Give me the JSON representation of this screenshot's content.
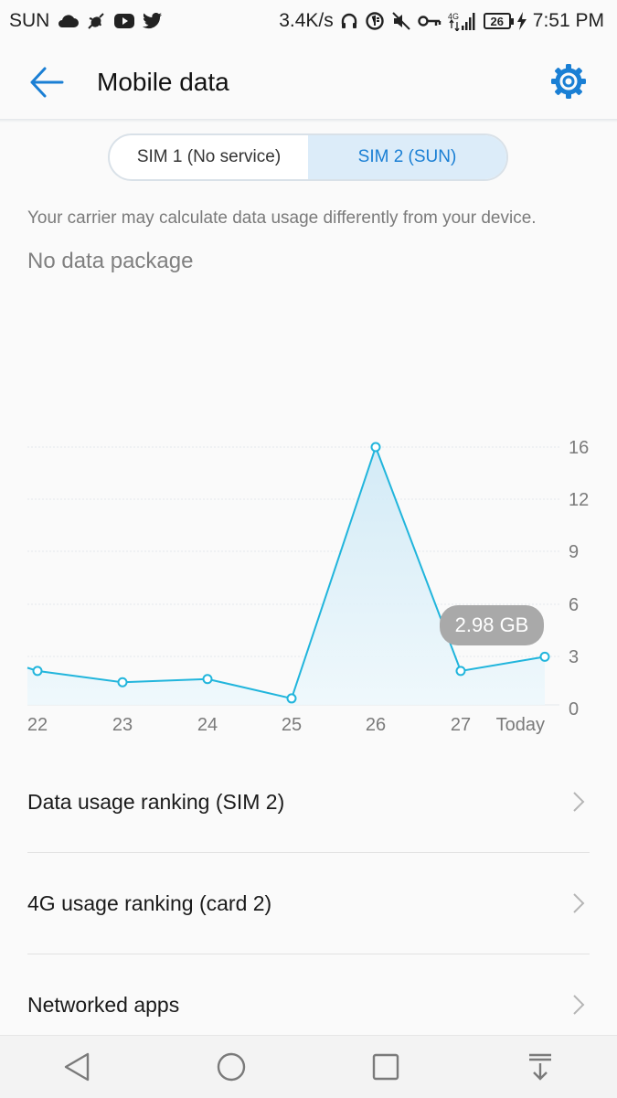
{
  "status_bar": {
    "carrier": "SUN",
    "net_speed": "3.4K/s",
    "network": "4G",
    "battery_level": "26",
    "time": "7:51 PM",
    "icons": [
      "cloud-icon",
      "bug-icon",
      "youtube-icon",
      "twitter-icon",
      "headphones-icon",
      "data-saver-icon",
      "mute-icon",
      "key-icon",
      "signal-icon",
      "battery-icon",
      "charging-icon"
    ]
  },
  "app_bar": {
    "title": "Mobile data"
  },
  "sim_tabs": [
    {
      "label": "SIM 1 (No service)",
      "selected": false
    },
    {
      "label": "SIM 2 (SUN)",
      "selected": true
    }
  ],
  "carrier_note": "Your carrier may calculate data usage differently from your device.",
  "package_status": "No data package",
  "chart_data": {
    "type": "area",
    "x_labels": [
      "22",
      "23",
      "24",
      "25",
      "26",
      "27",
      "Today"
    ],
    "values": [
      2.1,
      1.4,
      1.6,
      0.4,
      16.0,
      2.1,
      2.98
    ],
    "yticks": [
      0,
      3,
      6,
      9,
      12,
      16
    ],
    "ylim": [
      0,
      16
    ],
    "grid": true,
    "line_color": "#21b5dc",
    "tooltip_label": "2.98 GB"
  },
  "list": [
    {
      "label": "Data usage ranking (SIM 2)"
    },
    {
      "label": "4G usage ranking (card 2)"
    },
    {
      "label": "Networked apps"
    }
  ],
  "colors": {
    "accent": "#1a7fd4",
    "chart_line": "#21b5dc"
  }
}
